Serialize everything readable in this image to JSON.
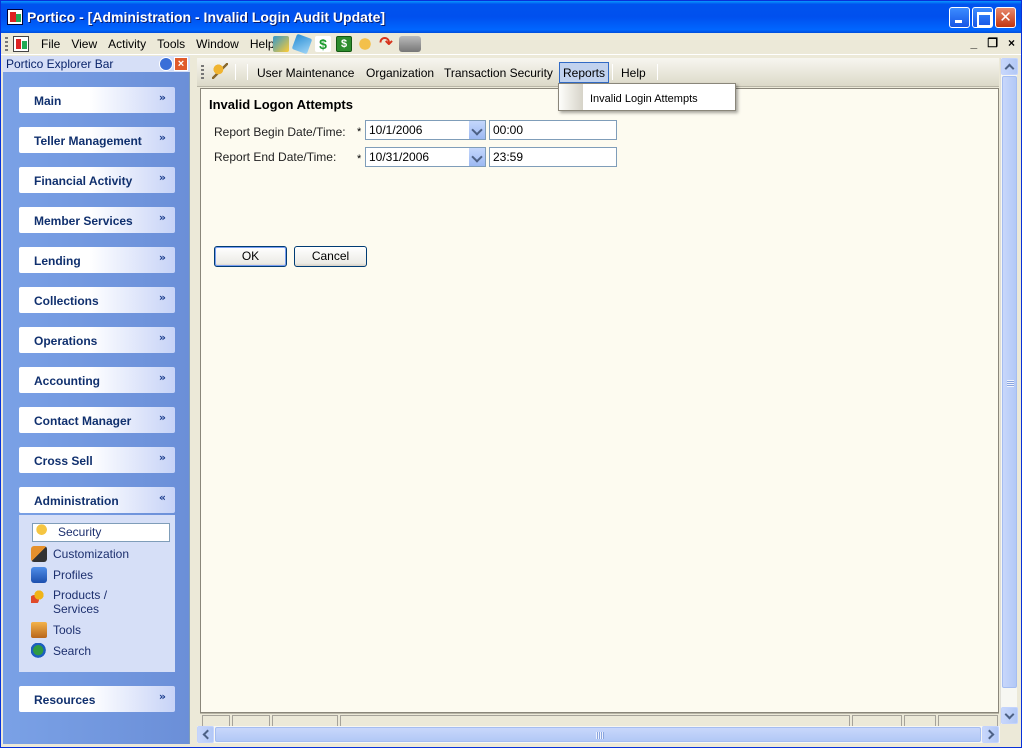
{
  "window": {
    "title": "Portico - [Administration - Invalid Login Audit Update]",
    "close_glyph": "✕"
  },
  "menubar": {
    "items": [
      "File",
      "View",
      "Activity",
      "Tools",
      "Window",
      "Help"
    ],
    "mdi_minimize": "_",
    "mdi_restore": "❐",
    "mdi_close": "×"
  },
  "explorer": {
    "title": "Portico Explorer Bar",
    "close_glyph": "×",
    "groups": [
      {
        "label": "Main",
        "chevron": "»"
      },
      {
        "label": "Teller Management",
        "chevron": "»"
      },
      {
        "label": "Financial Activity",
        "chevron": "»"
      },
      {
        "label": "Member Services",
        "chevron": "»"
      },
      {
        "label": "Lending",
        "chevron": "»"
      },
      {
        "label": "Collections",
        "chevron": "»"
      },
      {
        "label": "Operations",
        "chevron": "»"
      },
      {
        "label": "Accounting",
        "chevron": "»"
      },
      {
        "label": "Contact Manager",
        "chevron": "»"
      },
      {
        "label": "Cross Sell",
        "chevron": "»"
      },
      {
        "label": "Administration",
        "chevron": "«"
      },
      {
        "label": "Resources",
        "chevron": "»"
      }
    ],
    "admin_tasks": [
      {
        "label": "Security",
        "icon": "key-icon"
      },
      {
        "label": "Customization",
        "icon": "customization-icon"
      },
      {
        "label": "Profiles",
        "icon": "profiles-icon"
      },
      {
        "label": "Products / Services",
        "icon": "products-icon"
      },
      {
        "label": "Tools",
        "icon": "tools-icon"
      },
      {
        "label": "Search",
        "icon": "globe-search-icon"
      }
    ]
  },
  "subbar": {
    "items": [
      "User Maintenance",
      "Organization",
      "Transaction Security",
      "Reports",
      "Help"
    ],
    "active": "Reports",
    "dropdown_item": "Invalid Login Attempts"
  },
  "form": {
    "heading": "Invalid Logon Attempts",
    "begin_label": "Report Begin Date/Time:",
    "end_label": "Report End Date/Time:",
    "required_mark": "*",
    "begin_date": "10/1/2006",
    "begin_time": "00:00",
    "end_date": "10/31/2006",
    "end_time": "23:59",
    "ok": "OK",
    "cancel": "Cancel"
  }
}
